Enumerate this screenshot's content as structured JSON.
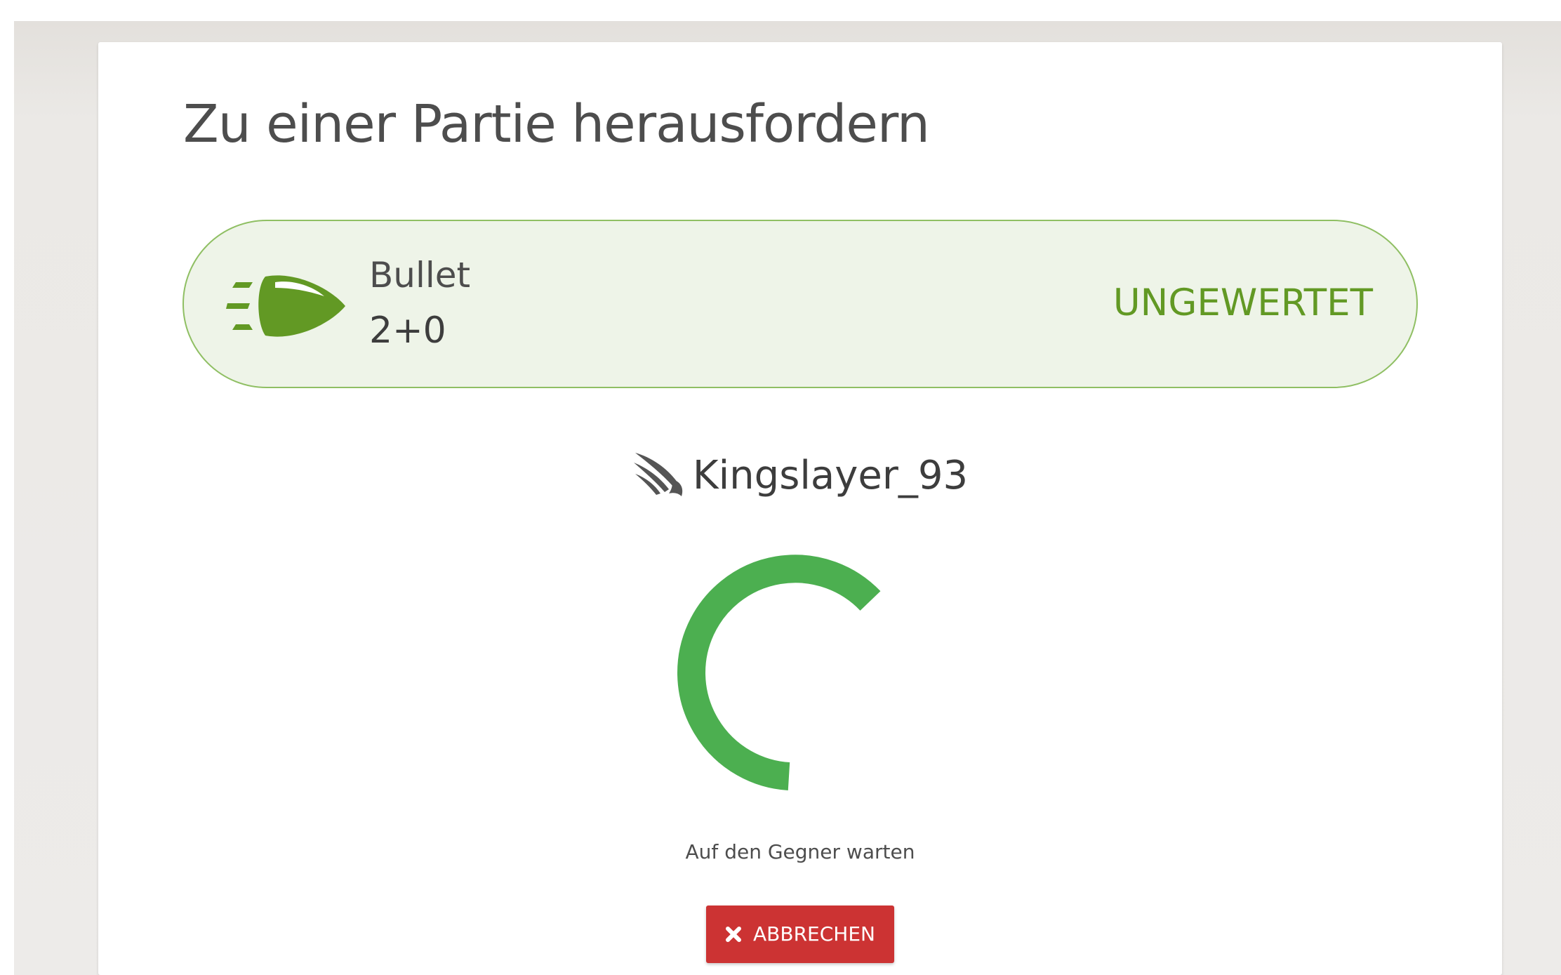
{
  "challenge": {
    "title": "Zu einer Partie herausfordern",
    "variant": {
      "icon": "bullet-icon",
      "name": "Bullet",
      "clock": "2+0",
      "mode": "UNGEWERTET"
    },
    "opponent": {
      "icon": "wing-icon",
      "name": "Kingslayer_93"
    },
    "status": {
      "spinner": "loading-spinner",
      "text": "Auf den Gegner warten"
    },
    "cancel_button": {
      "icon": "close-icon",
      "label": "ABBRECHEN"
    }
  },
  "colors": {
    "accent_green": "#629924",
    "spinner_green": "#4caf50",
    "pill_background": "#eef4e8",
    "pill_border": "#8fbf63",
    "cancel_red": "#cc3333",
    "page_background": "#edebe9"
  }
}
